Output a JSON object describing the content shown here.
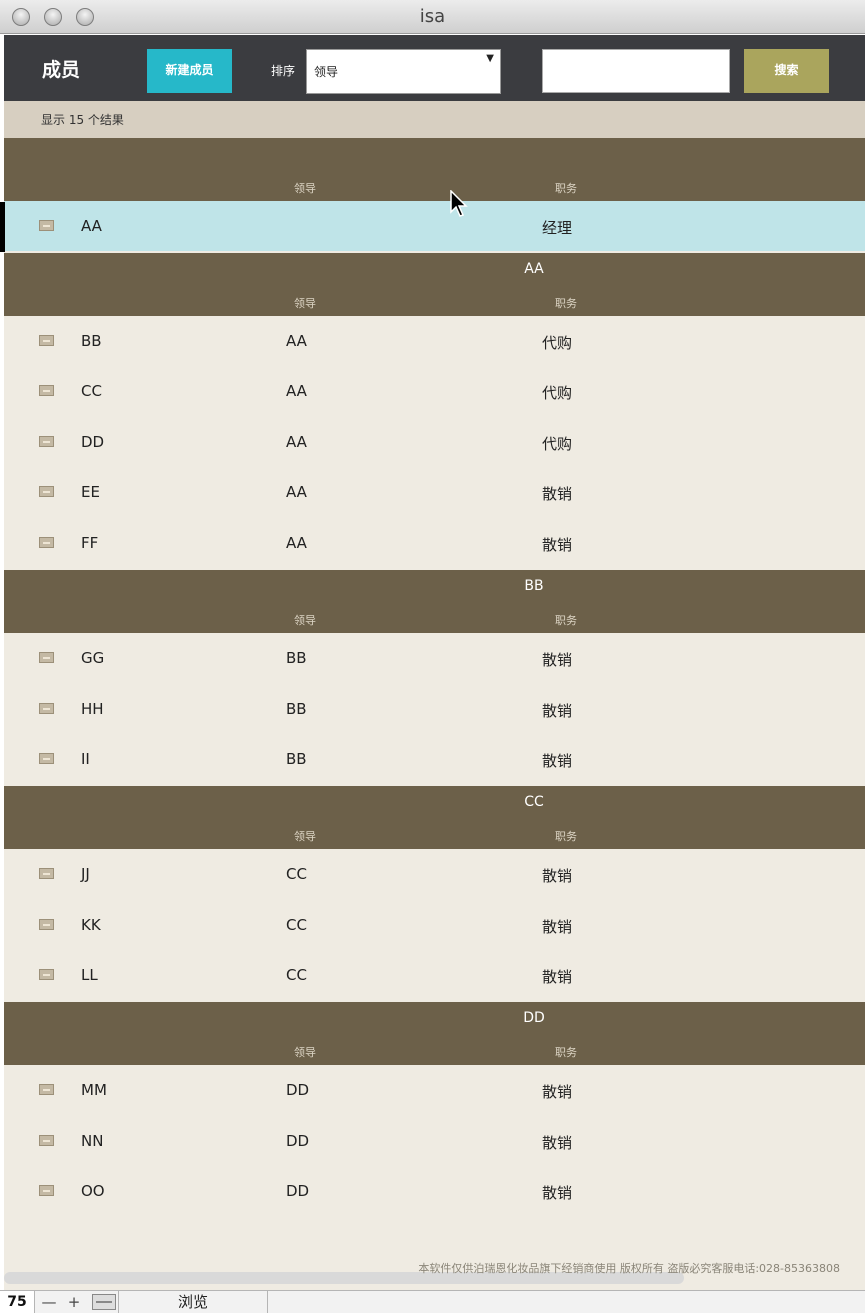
{
  "window": {
    "title": "isa"
  },
  "toolbar": {
    "title": "成员",
    "new_button": "新建成员",
    "sort_label": "排序",
    "sort_value": "领导",
    "search_value": "",
    "search_button": "搜索"
  },
  "result_text": "显示 15 个结果",
  "top_header": {
    "title": "",
    "col_leader": "领导",
    "col_role": "职务"
  },
  "top_row": {
    "name": "AA",
    "leader": "",
    "role": "经理"
  },
  "groups": [
    {
      "title": "AA",
      "col_leader": "领导",
      "col_role": "职务",
      "rows": [
        {
          "name": "BB",
          "leader": "AA",
          "role": "代购"
        },
        {
          "name": "CC",
          "leader": "AA",
          "role": "代购"
        },
        {
          "name": "DD",
          "leader": "AA",
          "role": "代购"
        },
        {
          "name": "EE",
          "leader": "AA",
          "role": "散销"
        },
        {
          "name": "FF",
          "leader": "AA",
          "role": "散销"
        }
      ]
    },
    {
      "title": "BB",
      "col_leader": "领导",
      "col_role": "职务",
      "rows": [
        {
          "name": "GG",
          "leader": "BB",
          "role": "散销"
        },
        {
          "name": "HH",
          "leader": "BB",
          "role": "散销"
        },
        {
          "name": "II",
          "leader": "BB",
          "role": "散销"
        }
      ]
    },
    {
      "title": "CC",
      "col_leader": "领导",
      "col_role": "职务",
      "rows": [
        {
          "name": "JJ",
          "leader": "CC",
          "role": "散销"
        },
        {
          "name": "KK",
          "leader": "CC",
          "role": "散销"
        },
        {
          "name": "LL",
          "leader": "CC",
          "role": "散销"
        }
      ]
    },
    {
      "title": "DD",
      "col_leader": "领导",
      "col_role": "职务",
      "rows": [
        {
          "name": "MM",
          "leader": "DD",
          "role": "散销"
        },
        {
          "name": "NN",
          "leader": "DD",
          "role": "散销"
        },
        {
          "name": "OO",
          "leader": "DD",
          "role": "散销"
        }
      ]
    }
  ],
  "footer_text": "本软件仅供泊瑞恩化妆品旗下经销商使用 版权所有 盗版必究客服电话:028-85363808",
  "statusbar": {
    "zoom": "75",
    "zoom_out": "—",
    "zoom_in": "+",
    "mode": "浏览"
  }
}
